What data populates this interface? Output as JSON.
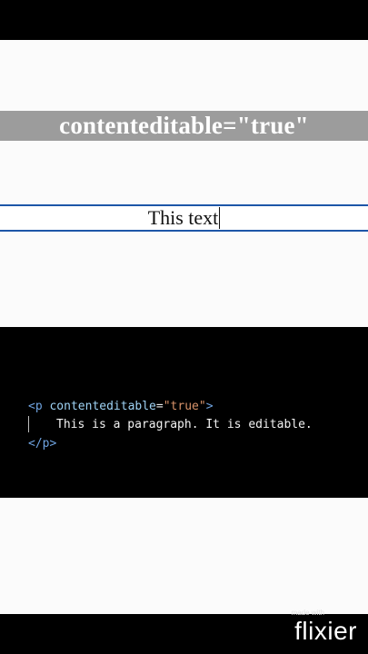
{
  "demo": {
    "title": "contenteditable=\"true\"",
    "editable_text": "This text"
  },
  "code": {
    "open_tag_start": "<p",
    "attr_name": "contenteditable",
    "eq": "=",
    "attr_value": "\"true\"",
    "open_tag_end": ">",
    "content": "This is a paragraph. It is editable.",
    "close_tag": "</p>"
  },
  "watermark": {
    "made_with": "made with",
    "brand": "flixier"
  }
}
